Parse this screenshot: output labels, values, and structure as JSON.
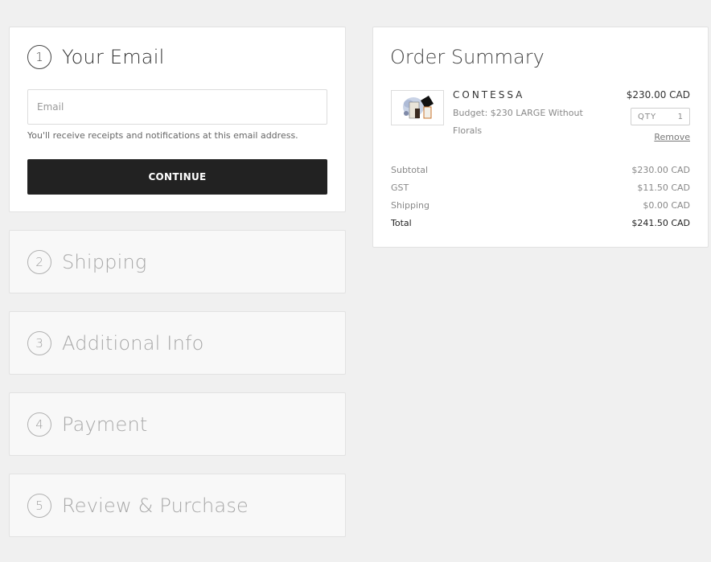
{
  "steps": [
    {
      "number": "1",
      "title": "Your Email"
    },
    {
      "number": "2",
      "title": "Shipping"
    },
    {
      "number": "3",
      "title": "Additional Info"
    },
    {
      "number": "4",
      "title": "Payment"
    },
    {
      "number": "5",
      "title": "Review & Purchase"
    }
  ],
  "email": {
    "value": "",
    "placeholder": "Email",
    "helper": "You'll receive receipts and notifications at this email address.",
    "button": "CONTINUE"
  },
  "summary": {
    "title": "Order Summary",
    "item": {
      "name": "CONTESSA",
      "description": "Budget: $230 LARGE Without Florals",
      "price": "$230.00 CAD",
      "qty_label": "QTY",
      "qty": "1",
      "remove": "Remove",
      "thumbnail_icon": "gift-box-thumbnail"
    },
    "totals": [
      {
        "label": "Subtotal",
        "value": "$230.00 CAD"
      },
      {
        "label": "GST",
        "value": "$11.50 CAD"
      },
      {
        "label": "Shipping",
        "value": "$0.00 CAD"
      },
      {
        "label": "Total",
        "value": "$241.50 CAD"
      }
    ]
  }
}
